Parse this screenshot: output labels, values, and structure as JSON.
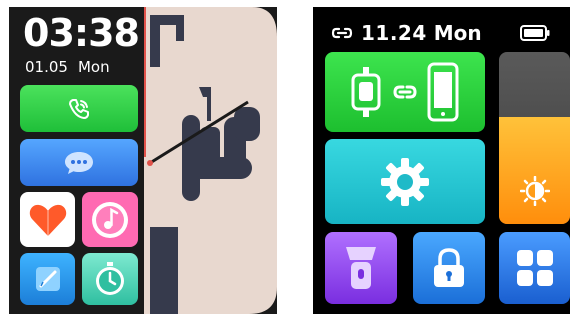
{
  "left_watch": {
    "time": "03:38",
    "date": "01.05",
    "day": "Mon",
    "tiles": [
      {
        "name": "phone",
        "icon": "phone-icon"
      },
      {
        "name": "messages",
        "icon": "chat-bubble-icon"
      },
      {
        "name": "health",
        "icon": "heart-icon"
      },
      {
        "name": "music",
        "icon": "music-disc-icon"
      },
      {
        "name": "edit",
        "icon": "pencil-icon"
      },
      {
        "name": "stopwatch",
        "icon": "stopwatch-icon"
      }
    ]
  },
  "right_watch": {
    "time": "11.24",
    "day": "Mon",
    "link_icon": "link-icon",
    "battery_icon": "battery-icon",
    "brightness_level": 0.62,
    "tiles": [
      {
        "name": "phone-watch-connect",
        "icon": "watch-phone-link-icon"
      },
      {
        "name": "brightness",
        "icon": "brightness-icon"
      },
      {
        "name": "settings",
        "icon": "gear-icon"
      },
      {
        "name": "flashlight",
        "icon": "flashlight-icon"
      },
      {
        "name": "lock",
        "icon": "lock-icon"
      },
      {
        "name": "apps",
        "icon": "apps-grid-icon"
      }
    ]
  },
  "colors": {
    "green": "#2fd047",
    "blue": "#3f8cf0",
    "pink": "#ff6ab2",
    "cyan": "#22c3d0",
    "orange": "#ffa820",
    "purple": "#9a55f5",
    "face_bg": "#e8d8cf",
    "face_shape": "#363a4c"
  }
}
